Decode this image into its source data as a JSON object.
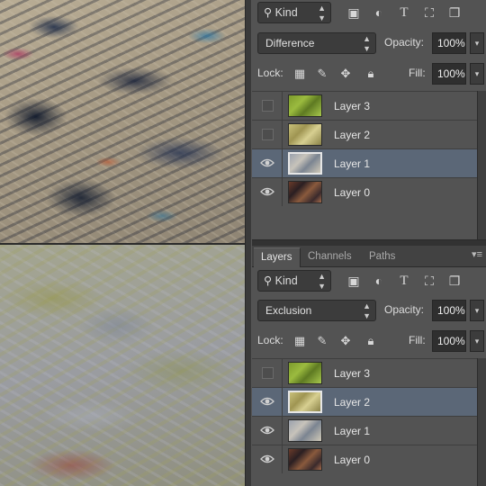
{
  "top_panel": {
    "filter": {
      "label": "Kind"
    },
    "blend_mode": "Difference",
    "opacity_label": "Opacity:",
    "opacity_value": "100%",
    "lock_label": "Lock:",
    "fill_label": "Fill:",
    "fill_value": "100%",
    "layers": [
      {
        "name": "Layer 3",
        "visible": false,
        "selected": false,
        "thumb": "green"
      },
      {
        "name": "Layer 2",
        "visible": false,
        "selected": false,
        "thumb": "yellow"
      },
      {
        "name": "Layer 1",
        "visible": true,
        "selected": true,
        "thumb": "gray"
      },
      {
        "name": "Layer 0",
        "visible": true,
        "selected": false,
        "thumb": "brown"
      }
    ]
  },
  "bottom_panel": {
    "tabs": [
      "Layers",
      "Channels",
      "Paths"
    ],
    "active_tab": "Layers",
    "filter": {
      "label": "Kind"
    },
    "blend_mode": "Exclusion",
    "opacity_label": "Opacity:",
    "opacity_value": "100%",
    "lock_label": "Lock:",
    "fill_label": "Fill:",
    "fill_value": "100%",
    "layers": [
      {
        "name": "Layer 3",
        "visible": false,
        "selected": false,
        "thumb": "green"
      },
      {
        "name": "Layer 2",
        "visible": true,
        "selected": true,
        "thumb": "yellow"
      },
      {
        "name": "Layer 1",
        "visible": true,
        "selected": false,
        "thumb": "gray"
      },
      {
        "name": "Layer 0",
        "visible": true,
        "selected": false,
        "thumb": "brown"
      }
    ]
  },
  "icons": {
    "filter": [
      "image-filter-icon",
      "adjustment-filter-icon",
      "type-filter-icon",
      "shape-filter-icon",
      "smart-object-filter-icon"
    ],
    "lock": [
      "lock-transparent-icon",
      "lock-image-icon",
      "lock-position-icon",
      "lock-all-icon"
    ]
  },
  "colors": {
    "panel_bg": "#535353",
    "selected_row": "#5b6777",
    "field_bg": "#2f2f2f"
  }
}
